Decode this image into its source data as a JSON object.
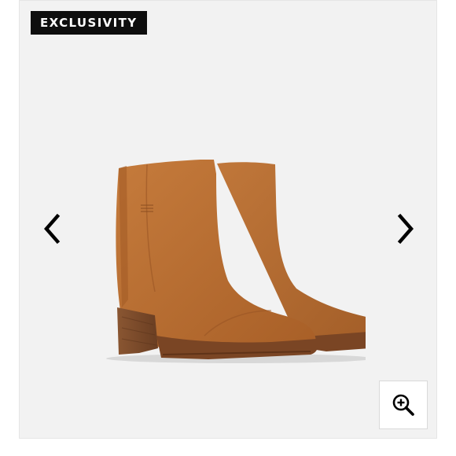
{
  "badge": {
    "label": "EXCLUSIVITY"
  },
  "product": {
    "image_icon": "ankle-boots-image"
  },
  "controls": {
    "prev_icon": "chevron-left-icon",
    "next_icon": "chevron-right-icon",
    "zoom_icon": "zoom-in-icon"
  },
  "colors": {
    "badge_bg": "#0e0e0e",
    "badge_text": "#ffffff",
    "background": "#f2f2f2",
    "suede": "#b36b2f"
  }
}
